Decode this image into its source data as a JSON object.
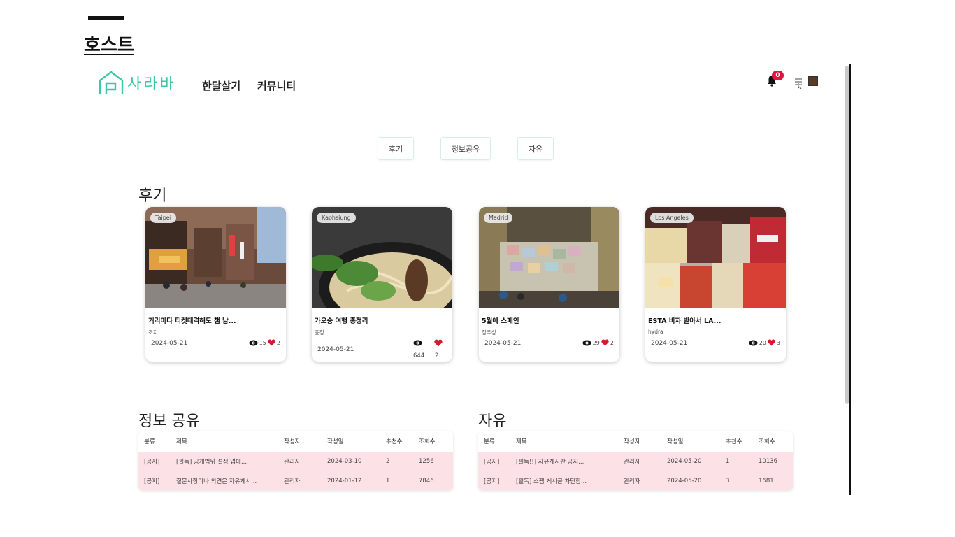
{
  "slide": {
    "title": "호스트"
  },
  "header": {
    "logo_text": "사라바",
    "nav": [
      "한달살기",
      "커뮤니티"
    ],
    "notification_count": "0"
  },
  "tabs": [
    "후기",
    "정보공유",
    "자유"
  ],
  "reviews": {
    "title": "후기",
    "cards": [
      {
        "tag": "Taipei",
        "title": "거리마다 티켓태격해도 챔 남...",
        "author": "조지",
        "date": "2024-05-21",
        "views": "15",
        "likes": "2"
      },
      {
        "tag": "Kaohsiung",
        "title": "가오슝 여행 총정리",
        "author": "윤정",
        "date": "2024-05-21",
        "views": "644",
        "likes": "2"
      },
      {
        "tag": "Madrid",
        "title": "5월에 스페인",
        "author": "정우성",
        "date": "2024-05-21",
        "views": "29",
        "likes": "2"
      },
      {
        "tag": "Los Angeles",
        "title": "ESTA 비자 받아서 LA...",
        "author": "hydra",
        "date": "2024-05-21",
        "views": "20",
        "likes": "3"
      }
    ]
  },
  "info_share": {
    "title": "정보 공유",
    "columns": [
      "분류",
      "제목",
      "작성자",
      "작성일",
      "추천수",
      "조회수"
    ],
    "rows": [
      [
        "[공지]",
        "[필독] 공개범위 설정 업데...",
        "관리자",
        "2024-03-10",
        "2",
        "1256"
      ],
      [
        "[공지]",
        "질문사항이나 의견은 자유게시...",
        "관리자",
        "2024-01-12",
        "1",
        "7846"
      ]
    ]
  },
  "free": {
    "title": "자유",
    "columns": [
      "분류",
      "제목",
      "작성자",
      "작성일",
      "추천수",
      "조회수"
    ],
    "rows": [
      [
        "[공지]",
        "[필독!!] 자유게시판 공지...",
        "관리자",
        "2024-05-20",
        "1",
        "10136"
      ],
      [
        "[공지]",
        "[필독] 스팸 게시글 차단합...",
        "관리자",
        "2024-05-20",
        "3",
        "1681"
      ]
    ]
  },
  "colors": {
    "brand": "#3ec6a8",
    "notice_row": "#fce2e6",
    "heart": "#d7182f",
    "badge": "#e2143d"
  }
}
